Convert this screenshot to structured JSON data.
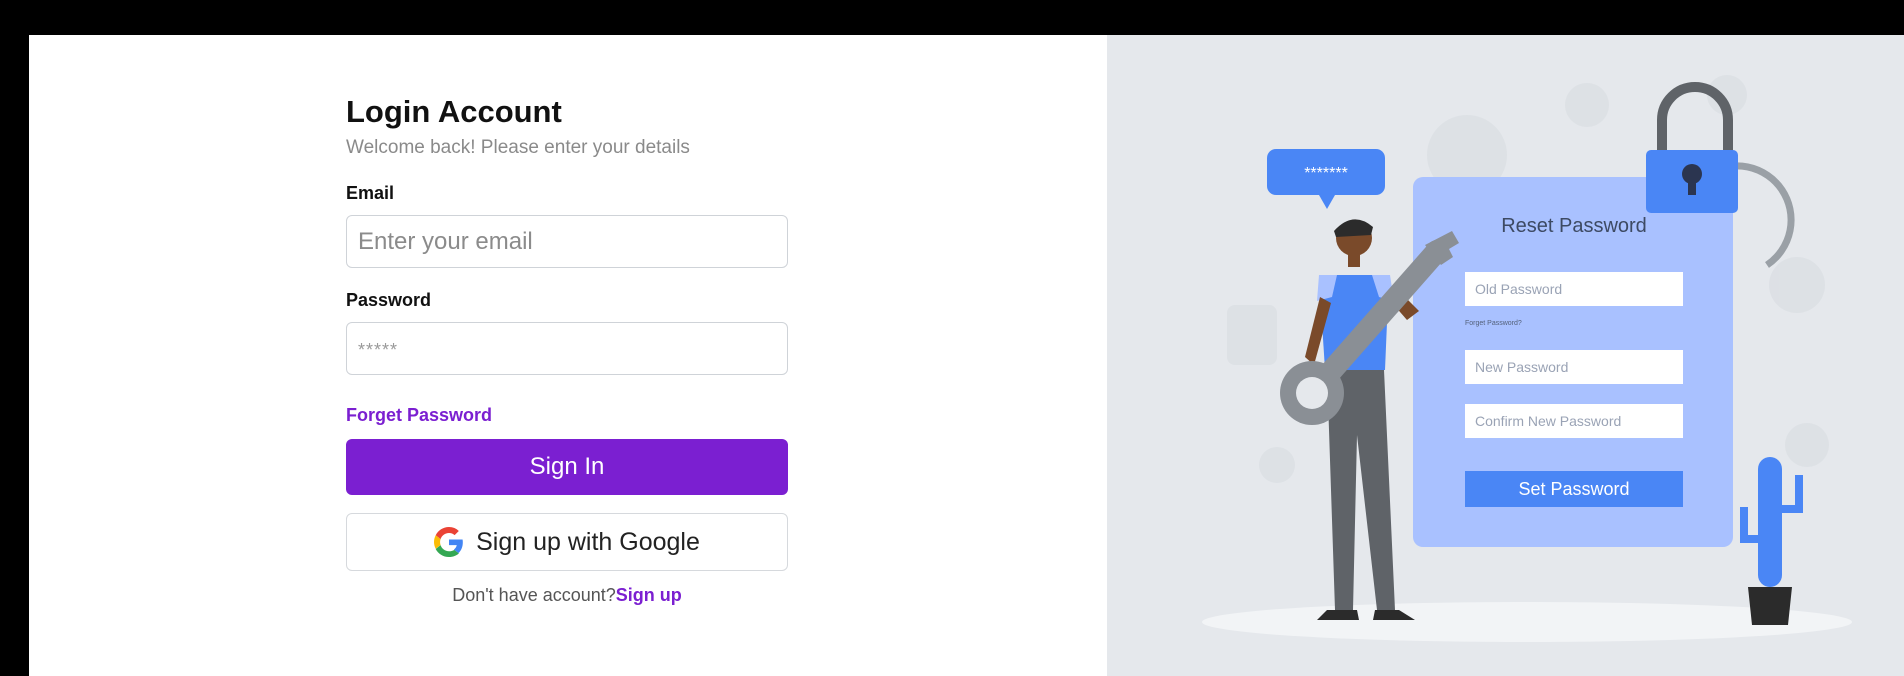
{
  "login": {
    "title": "Login Account",
    "subtitle": "Welcome back! Please enter your details",
    "email_label": "Email",
    "email_placeholder": "Enter your email",
    "password_label": "Password",
    "password_placeholder": "*****",
    "forget_password": "Forget Password",
    "sign_in": "Sign In",
    "google_button": "Sign up with Google",
    "no_account_text": "Don't have account?",
    "sign_up_link": "Sign up"
  },
  "illustration": {
    "bubble_text": "*******",
    "card_title": "Reset Password",
    "old_password": "Old Password",
    "forget_small": "Forget Password?",
    "new_password": "New Password",
    "confirm_password": "Confirm New Password",
    "set_password": "Set Password"
  },
  "colors": {
    "accent": "#7b1fd1",
    "illustration_bg": "#e5e8ec",
    "card_blue": "#a9c1ff",
    "button_blue": "#4a86f5"
  }
}
